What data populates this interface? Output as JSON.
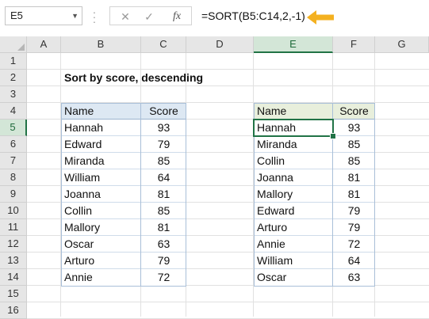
{
  "formula_bar": {
    "name_box": "E5",
    "fx_label": "fx",
    "formula": "=SORT(B5:C14,2,-1)",
    "arrow_color": "#f4b120"
  },
  "columns": [
    "A",
    "B",
    "C",
    "D",
    "E",
    "F",
    "G"
  ],
  "rows": [
    "1",
    "2",
    "3",
    "4",
    "5",
    "6",
    "7",
    "8",
    "9",
    "10",
    "11",
    "12",
    "13",
    "14",
    "15",
    "16"
  ],
  "selected": {
    "column": "E",
    "row": "5"
  },
  "sheet": {
    "title": "Sort by score, descending",
    "source_table": {
      "headers": [
        "Name",
        "Score"
      ],
      "rows": [
        [
          "Hannah",
          "93"
        ],
        [
          "Edward",
          "79"
        ],
        [
          "Miranda",
          "85"
        ],
        [
          "William",
          "64"
        ],
        [
          "Joanna",
          "81"
        ],
        [
          "Collin",
          "85"
        ],
        [
          "Mallory",
          "81"
        ],
        [
          "Oscar",
          "63"
        ],
        [
          "Arturo",
          "79"
        ],
        [
          "Annie",
          "72"
        ]
      ]
    },
    "sorted_table": {
      "headers": [
        "Name",
        "Score"
      ],
      "rows": [
        [
          "Hannah",
          "93"
        ],
        [
          "Miranda",
          "85"
        ],
        [
          "Collin",
          "85"
        ],
        [
          "Joanna",
          "81"
        ],
        [
          "Mallory",
          "81"
        ],
        [
          "Edward",
          "79"
        ],
        [
          "Arturo",
          "79"
        ],
        [
          "Annie",
          "72"
        ],
        [
          "William",
          "64"
        ],
        [
          "Oscar",
          "63"
        ]
      ]
    }
  }
}
